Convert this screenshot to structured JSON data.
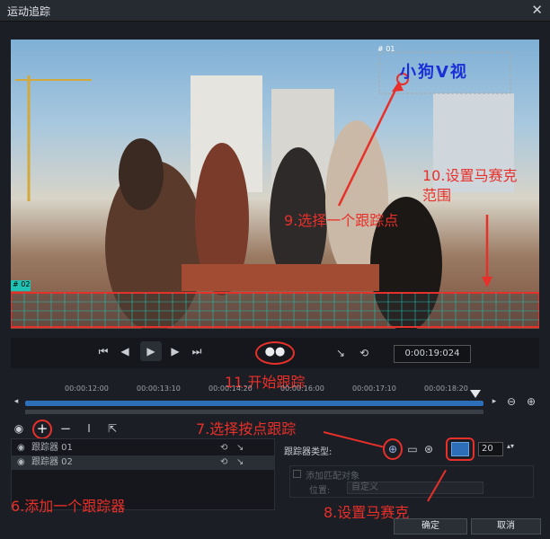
{
  "window": {
    "title": "运动追踪"
  },
  "preview": {
    "tracker_tag_1": "# 01",
    "tracker_tag_2": "# 02",
    "watermark_text": "小狗V视"
  },
  "playback": {
    "timecode": "0:00:19:024"
  },
  "timeline": {
    "ticks": [
      "00:00:12:00",
      "00:00:13:10",
      "00:00:14:20",
      "00:00:16:00",
      "00:00:17:10",
      "00:00:18:20"
    ]
  },
  "trackers": {
    "items": [
      {
        "label": "跟踪器 01"
      },
      {
        "label": "跟踪器 02"
      }
    ]
  },
  "properties": {
    "tracker_type_label": "跟踪器类型:",
    "mosaic_size": "20",
    "add_match_label": "添加匹配对象",
    "position_label": "位置:",
    "position_value": "自定义"
  },
  "buttons": {
    "ok": "确定",
    "cancel": "取消"
  },
  "annotations": {
    "a6": "6.添加一个跟踪器",
    "a7": "7.选择按点跟踪",
    "a8": "8.设置马赛克",
    "a9": "9.选择一个跟踪点",
    "a10_line1": "10.设置马赛克",
    "a10_line2": "范围",
    "a11": "11.开始跟踪"
  },
  "colors": {
    "accent_red": "#e8302a",
    "tracker_cyan": "#1fc2b3",
    "scrub_blue": "#2c6fb8"
  }
}
